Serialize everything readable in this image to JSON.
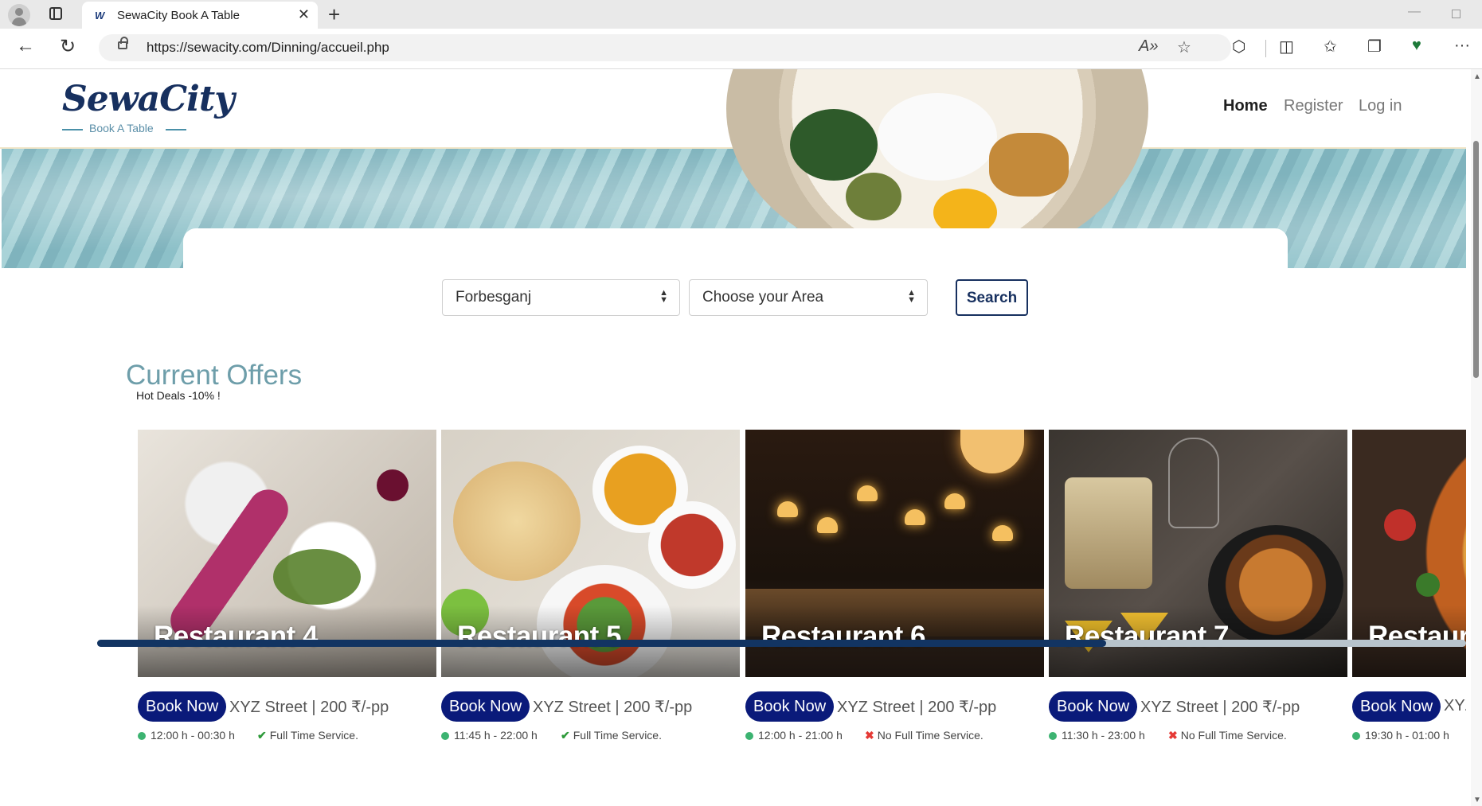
{
  "browser": {
    "tab_title": "SewaCity Book A Table",
    "tab_favicon": "W",
    "url": "https://sewacity.com/Dinning/accueil.php",
    "icons": [
      "profile-icon",
      "tab-actions-icon",
      "close-icon",
      "new-tab-icon",
      "back-icon",
      "refresh-icon",
      "lock-icon",
      "read-aloud-icon",
      "favorite-star-icon",
      "extensions-icon",
      "split-screen-icon",
      "favorites-icon",
      "collections-icon",
      "browser-essentials-icon",
      "more-icon"
    ]
  },
  "site": {
    "logo": "SewaCity",
    "tagline": "Book A Table",
    "nav": {
      "home": "Home",
      "register": "Register",
      "login": "Log in"
    }
  },
  "search": {
    "city_value": "Forbesganj",
    "area_placeholder": "Choose your Area",
    "button": "Search"
  },
  "offers": {
    "title": "Current Offers",
    "subtitle": "Hot Deals -10% !",
    "book_label": "Book Now",
    "restaurants": [
      {
        "name": "Restaurant 4",
        "address": "XYZ Street | 200 ₹/-pp",
        "hours": "12:00 h - 00:30 h",
        "service": "Full Time Service.",
        "full_time": true
      },
      {
        "name": "Restaurant 5",
        "address": "XYZ Street | 200 ₹/-pp",
        "hours": "11:45 h - 22:00 h",
        "service": "Full Time Service.",
        "full_time": true
      },
      {
        "name": "Restaurant 6",
        "address": "XYZ Street | 200 ₹/-pp",
        "hours": "12:00 h - 21:00 h",
        "service": "No Full Time Service.",
        "full_time": false
      },
      {
        "name": "Restaurant 7",
        "address": "XYZ Street | 200 ₹/-pp",
        "hours": "11:30 h - 23:00 h",
        "service": "No Full Time Service.",
        "full_time": false
      },
      {
        "name": "Restaura",
        "address": "XYZ",
        "hours": "19:30 h - 01:00 h",
        "service": "",
        "full_time": null
      }
    ]
  },
  "carousel_scroll": {
    "position_fraction": 0.74
  },
  "colors": {
    "brand_navy": "#17305f",
    "book_button": "#0a1a7a",
    "section_title": "#6e9eaa",
    "ok_green": "#2e9a3a",
    "no_red": "#e53935"
  }
}
